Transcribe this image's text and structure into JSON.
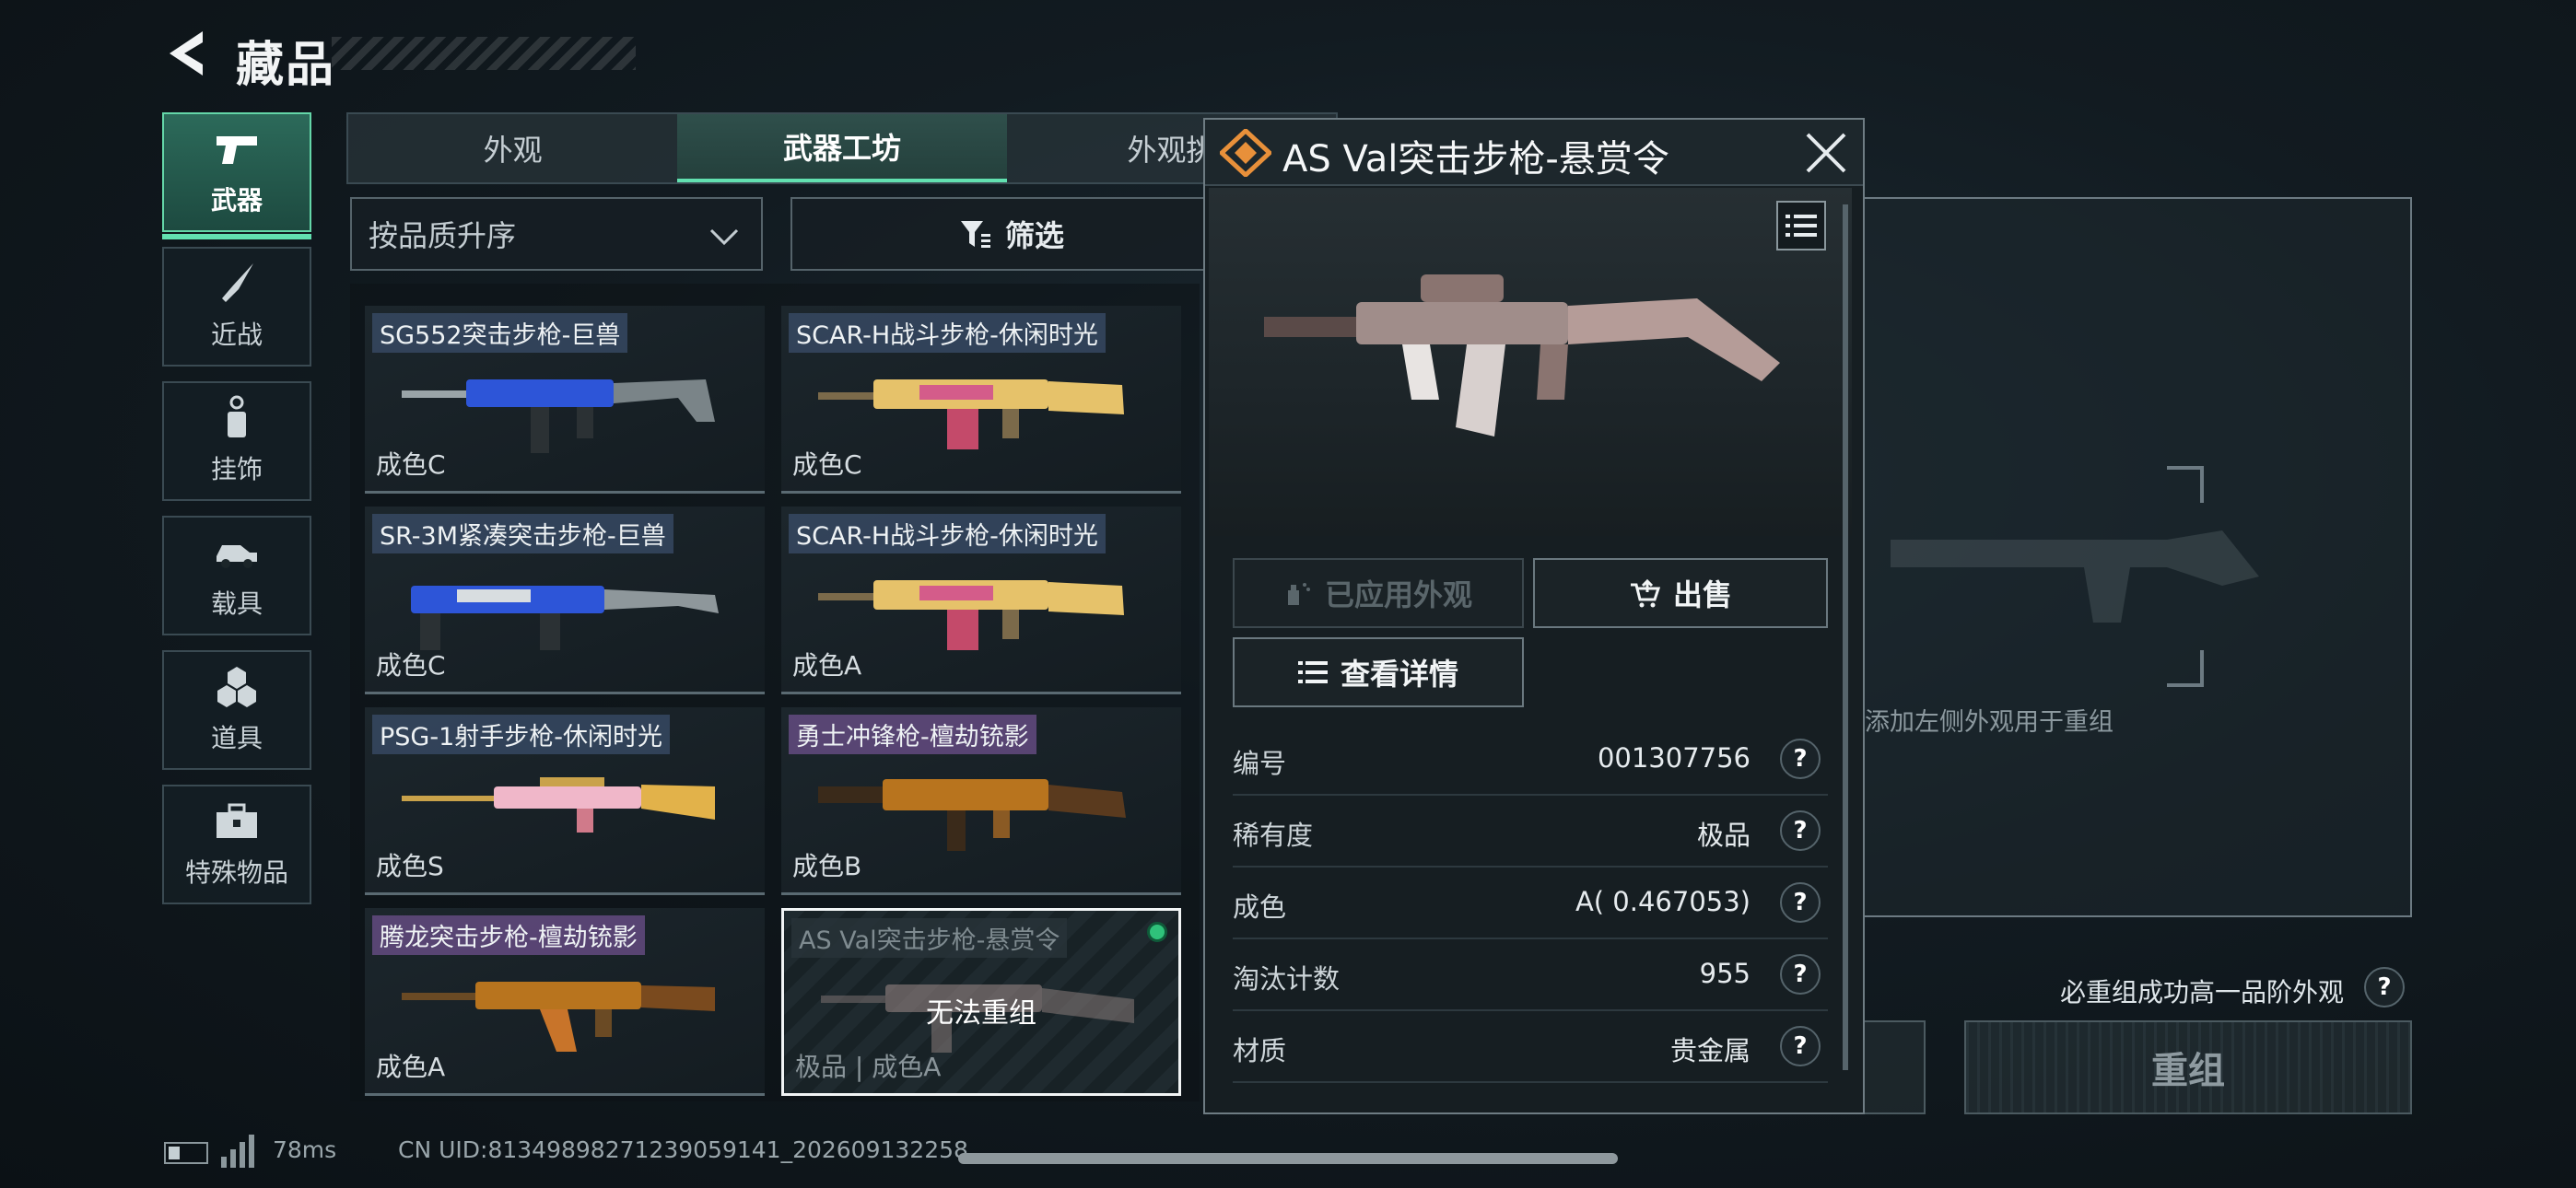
{
  "header": {
    "title": "藏品"
  },
  "categories": [
    {
      "label": "武器",
      "icon": "pistol-icon",
      "active": true
    },
    {
      "label": "近战",
      "icon": "knife-icon",
      "active": false
    },
    {
      "label": "挂饰",
      "icon": "charm-icon",
      "active": false
    },
    {
      "label": "载具",
      "icon": "vehicle-icon",
      "active": false
    },
    {
      "label": "道具",
      "icon": "items-icon",
      "active": false
    },
    {
      "label": "特殊物品",
      "icon": "briefcase-icon",
      "active": false
    }
  ],
  "tabs": [
    {
      "label": "外观",
      "active": false
    },
    {
      "label": "武器工坊",
      "active": true
    },
    {
      "label": "外观挑",
      "active": false
    }
  ],
  "sort": {
    "label": "按品质升序"
  },
  "filter": {
    "label": "筛选"
  },
  "items": [
    {
      "name": "SG552突击步枪-巨兽",
      "condition": "成色C",
      "accent": "#2d55d8"
    },
    {
      "name": "SCAR-H战斗步枪-休闲时光",
      "condition": "成色C",
      "accent": "#e6c26a"
    },
    {
      "name": "SR-3M紧凑突击步枪-巨兽",
      "condition": "成色C",
      "accent": "#2d55d8"
    },
    {
      "name": "SCAR-H战斗步枪-休闲时光",
      "condition": "成色A",
      "accent": "#e6c26a"
    },
    {
      "name": "PSG-1射手步枪-休闲时光",
      "condition": "成色S",
      "accent": "#f0b7c9"
    },
    {
      "name": "勇士冲锋枪-檀劫铳影",
      "condition": "成色B",
      "accent": "#b8741e"
    },
    {
      "name": "腾龙突击步枪-檀劫铳影",
      "condition": "成色A",
      "accent": "#b8741e"
    },
    {
      "name": "AS Val突击步枪-悬赏令",
      "condition": "极品 | 成色A",
      "overlay": "无法重组",
      "accent": "#a08d8a"
    }
  ],
  "detail": {
    "title": "AS Val突击步枪-悬赏令",
    "applied_label": "已应用外观",
    "sell_label": "出售",
    "details_label": "查看详情",
    "rows": [
      {
        "key": "编号",
        "value": "001307756"
      },
      {
        "key": "稀有度",
        "value": "极品"
      },
      {
        "key": "成色",
        "value": "A( 0.467053)"
      },
      {
        "key": "淘汰计数",
        "value": "955"
      },
      {
        "key": "材质",
        "value": "贵金属"
      }
    ]
  },
  "right_panel": {
    "hint": "添加左侧外观用于重组",
    "note": "必重组成功高一品阶外观",
    "recombine_label": "重组"
  },
  "status": {
    "ping": "78ms",
    "uid": "CN UID:8134989827123905914​1_2026091322​58"
  },
  "colors": {
    "accent": "#62e0b0",
    "rarity": "#e8903a"
  }
}
